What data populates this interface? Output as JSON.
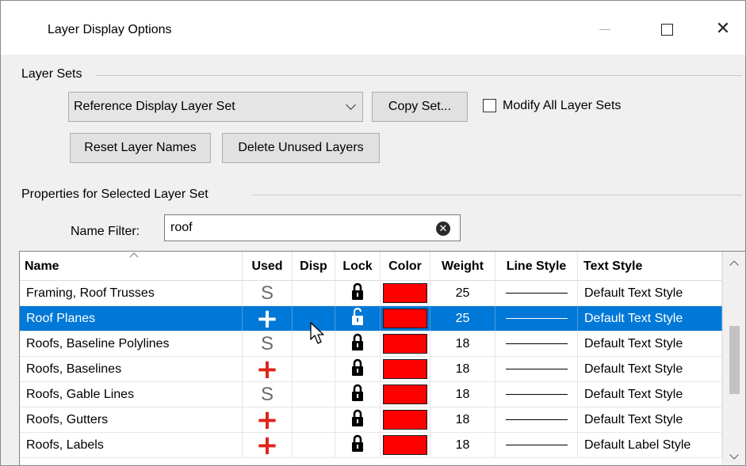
{
  "window": {
    "title": "Layer Display Options",
    "controls": {
      "minimize": "minimize-icon",
      "maximize": "maximize-icon",
      "close": "close-icon"
    }
  },
  "layer_sets": {
    "group_label": "Layer Sets",
    "selected_set": "Reference Display Layer Set",
    "copy_button": "Copy Set...",
    "modify_all_label": "Modify All Layer Sets",
    "modify_all_checked": false,
    "reset_button": "Reset Layer Names",
    "delete_button": "Delete Unused Layers"
  },
  "properties": {
    "group_label": "Properties for Selected Layer Set",
    "name_filter_label": "Name Filter:",
    "name_filter_value": "roof"
  },
  "table": {
    "columns": [
      "Name",
      "Used",
      "Disp",
      "Lock",
      "Color",
      "Weight",
      "Line Style",
      "Text Style"
    ],
    "sorted_column": "Name",
    "rows": [
      {
        "name": "Framing, Roof Trusses",
        "used": "S",
        "lock": "locked",
        "color": "#ff0000",
        "weight": "25",
        "text_style": "Default Text Style",
        "selected": false
      },
      {
        "name": "Roof Planes",
        "used": "+",
        "lock": "unlocked",
        "color": "#ff0000",
        "weight": "25",
        "text_style": "Default Text Style",
        "selected": true
      },
      {
        "name": "Roofs, Baseline Polylines",
        "used": "S",
        "lock": "locked",
        "color": "#ff0000",
        "weight": "18",
        "text_style": "Default Text Style",
        "selected": false
      },
      {
        "name": "Roofs, Baselines",
        "used": "+",
        "lock": "locked",
        "color": "#ff0000",
        "weight": "18",
        "text_style": "Default Text Style",
        "selected": false
      },
      {
        "name": "Roofs, Gable Lines",
        "used": "S",
        "lock": "locked",
        "color": "#ff0000",
        "weight": "18",
        "text_style": "Default Text Style",
        "selected": false
      },
      {
        "name": "Roofs, Gutters",
        "used": "+",
        "lock": "locked",
        "color": "#ff0000",
        "weight": "18",
        "text_style": "Default Text Style",
        "selected": false
      },
      {
        "name": "Roofs, Labels",
        "used": "+",
        "lock": "locked",
        "color": "#ff0000",
        "weight": "18",
        "text_style": "Default Label Style",
        "selected": false
      }
    ]
  },
  "colors": {
    "selection": "#0078d7",
    "layer_color": "#ff0000",
    "used_plus": "#e0231a"
  }
}
